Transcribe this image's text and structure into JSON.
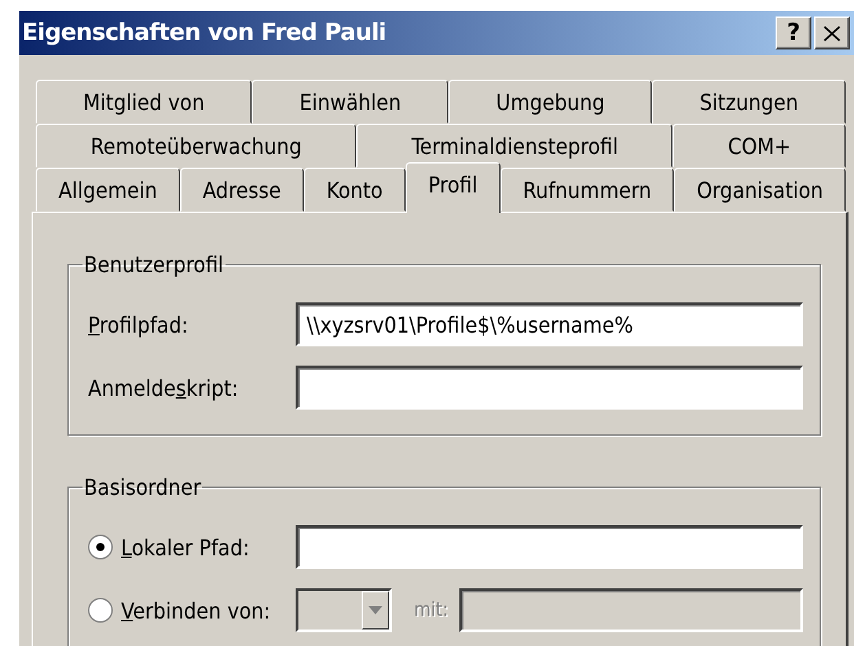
{
  "window": {
    "title": "Eigenschaften von Fred Pauli",
    "help_button": "?"
  },
  "tab_rows": [
    [
      {
        "label": "Mitglied von",
        "selected": false
      },
      {
        "label": "Einwählen",
        "selected": false
      },
      {
        "label": "Umgebung",
        "selected": false
      },
      {
        "label": "Sitzungen",
        "selected": false
      }
    ],
    [
      {
        "label": "Remoteüberwachung",
        "selected": false
      },
      {
        "label": "Terminaldiensteprofil",
        "selected": false
      },
      {
        "label": "COM+",
        "selected": false
      }
    ],
    [
      {
        "label": "Allgemein",
        "selected": false
      },
      {
        "label": "Adresse",
        "selected": false
      },
      {
        "label": "Konto",
        "selected": false
      },
      {
        "label": "Profil",
        "selected": true
      },
      {
        "label": "Rufnummern",
        "selected": false
      },
      {
        "label": "Organisation",
        "selected": false
      }
    ]
  ],
  "user_profile": {
    "title": "Benutzerprofil",
    "fields": [
      {
        "label_parts": [
          {
            "text": "P",
            "underlined": true
          },
          {
            "text": "rofilpfad:",
            "underlined": false
          }
        ],
        "value": "\\\\xyzsrv01\\Profile$\\%username%"
      },
      {
        "label_parts": [
          {
            "text": "Anmelde",
            "underlined": false
          },
          {
            "text": "s",
            "underlined": true
          },
          {
            "text": "kript:",
            "underlined": false
          }
        ]
      }
    ]
  },
  "home_folder": {
    "title": "Basisordner",
    "options": [
      {
        "kind": "path",
        "label_parts": [
          {
            "text": "L",
            "underlined": true
          },
          {
            "text": "okaler Pfad:",
            "underlined": false
          }
        ],
        "selected": true,
        "disabled": false
      },
      {
        "kind": "connect",
        "label_parts": [
          {
            "text": "V",
            "underlined": true
          },
          {
            "text": "erbinden von:",
            "underlined": false
          }
        ],
        "selected": false,
        "disabled": true,
        "to_label": "mit:"
      }
    ]
  }
}
